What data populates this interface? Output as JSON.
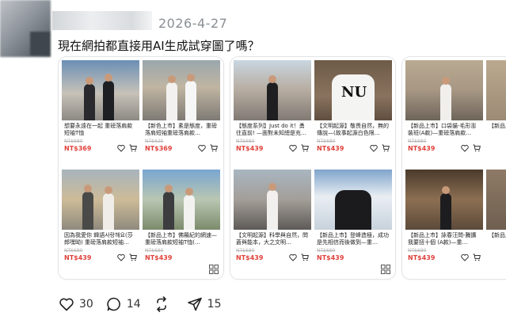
{
  "post": {
    "timestamp": "2026-4-27",
    "text": "現在網拍都直接用AI生成試穿圖了嗎？"
  },
  "cards": [
    {
      "tiles": [
        {
          "title": "想要永遠在一起 重磅落肩款短袖T恤",
          "old_price": "NT$680",
          "price": "NT$369"
        },
        {
          "title": "【新色上市】素是態度，重磅落肩短袖重磅落肩款…",
          "old_price": "NT$625",
          "price": "NT$369"
        },
        {
          "title": "因為我愛你 韓語사랑해요(莎郎嘿呦) 重磅落肩款短袖…",
          "old_price": "NT$680",
          "price": "NT$439"
        },
        {
          "title": "【新品上市】佛羅紀的網速—重磅落肩款短袖T恤(…",
          "old_price": "NT$680",
          "price": "NT$439"
        }
      ]
    },
    {
      "tiles": [
        {
          "title": "【態度系列】Just do it！勇往直前! —面對未知總是充…",
          "old_price": "NT$680",
          "price": "NT$439"
        },
        {
          "title": "【文明起源】敬畏自然，無的傳說—(故事起源白色限…",
          "old_price": "NT$680",
          "price": "NT$439"
        },
        {
          "title": "【文明起源】科學與自然，問蒼與能本，大之文明…",
          "old_price": "NT$680",
          "price": "NT$439"
        },
        {
          "title": "【新品上市】登峰造極，成功是先相信而後做到—重…",
          "old_price": "NT$680",
          "price": "NT$439"
        }
      ]
    },
    {
      "tiles": [
        {
          "title": "【新品上市】口袋貓-毛形澎裝班(A款)—重磅落肩款…",
          "old_price": "NT$680",
          "price": "NT$439"
        },
        {
          "title": "【新品上市】",
          "old_price": "",
          "price": ""
        },
        {
          "title": "【新品上市】詠春汪問-騰擴我要扭十個 (A款)—重…",
          "old_price": "NT$680",
          "price": "NT$439"
        },
        {
          "title": "【新品上市】宇宙暴…",
          "old_price": "",
          "price": ""
        }
      ]
    }
  ],
  "actions": {
    "likes": "30",
    "comments": "14",
    "reposts": "",
    "shares": "15"
  },
  "colors": {
    "price": "#e0413a",
    "timestamp": "#8a8f94"
  }
}
